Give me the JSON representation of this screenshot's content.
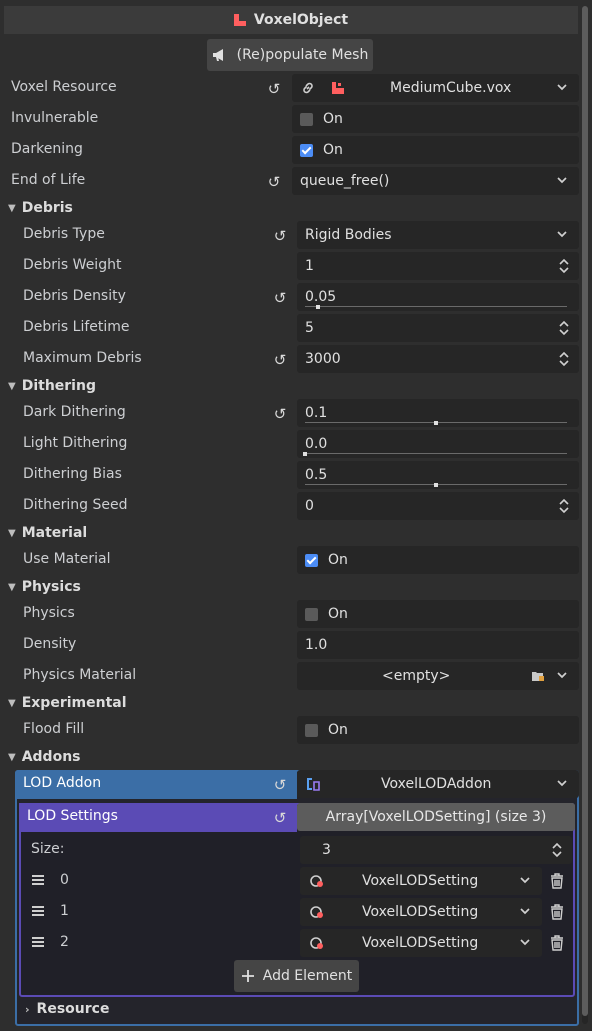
{
  "header": {
    "title": "VoxelObject"
  },
  "repopulate_button": "(Re)populate Mesh",
  "properties": {
    "voxel_resource": {
      "label": "Voxel Resource",
      "value": "MediumCube.vox"
    },
    "invulnerable": {
      "label": "Invulnerable",
      "value": "On",
      "checked": false
    },
    "darkening": {
      "label": "Darkening",
      "value": "On",
      "checked": true
    },
    "end_of_life": {
      "label": "End of Life",
      "value": "queue_free()"
    }
  },
  "sections": {
    "debris": {
      "title": "Debris",
      "debris_type": {
        "label": "Debris Type",
        "value": "Rigid Bodies"
      },
      "debris_weight": {
        "label": "Debris Weight",
        "value": "1"
      },
      "debris_density": {
        "label": "Debris Density",
        "value": "0.05",
        "fraction": 0.05
      },
      "debris_lifetime": {
        "label": "Debris Lifetime",
        "value": "5"
      },
      "maximum_debris": {
        "label": "Maximum Debris",
        "value": "3000"
      }
    },
    "dithering": {
      "title": "Dithering",
      "dark_dithering": {
        "label": "Dark Dithering",
        "value": "0.1",
        "fraction": 0.5
      },
      "light_dithering": {
        "label": "Light Dithering",
        "value": "0.0",
        "fraction": 0.0
      },
      "dithering_bias": {
        "label": "Dithering Bias",
        "value": "0.5",
        "fraction": 0.5
      },
      "dithering_seed": {
        "label": "Dithering Seed",
        "value": "0"
      }
    },
    "material": {
      "title": "Material",
      "use_material": {
        "label": "Use Material",
        "value": "On",
        "checked": true
      }
    },
    "physics": {
      "title": "Physics",
      "physics": {
        "label": "Physics",
        "value": "On",
        "checked": false
      },
      "density": {
        "label": "Density",
        "value": "1.0"
      },
      "physics_material": {
        "label": "Physics Material",
        "value": "<empty>"
      }
    },
    "experimental": {
      "title": "Experimental",
      "flood_fill": {
        "label": "Flood Fill",
        "value": "On",
        "checked": false
      }
    },
    "addons": {
      "title": "Addons",
      "lod_addon": {
        "label": "LOD Addon",
        "value": "VoxelLODAddon"
      },
      "lod_settings": {
        "label": "LOD Settings",
        "value": "Array[VoxelLODSetting] (size 3)",
        "size_label": "Size:",
        "size_value": "3",
        "items": [
          {
            "index": "0",
            "value": "VoxelLODSetting"
          },
          {
            "index": "1",
            "value": "VoxelLODSetting"
          },
          {
            "index": "2",
            "value": "VoxelLODSetting"
          }
        ],
        "add_element": "Add Element"
      },
      "resource": {
        "label": "Resource"
      }
    }
  },
  "colors": {
    "accent_blue": "#4c8df6",
    "addon_header": "#3b6ea6",
    "lod_header": "#5b4bb5",
    "voxel_icon": "#ff5f5f"
  }
}
